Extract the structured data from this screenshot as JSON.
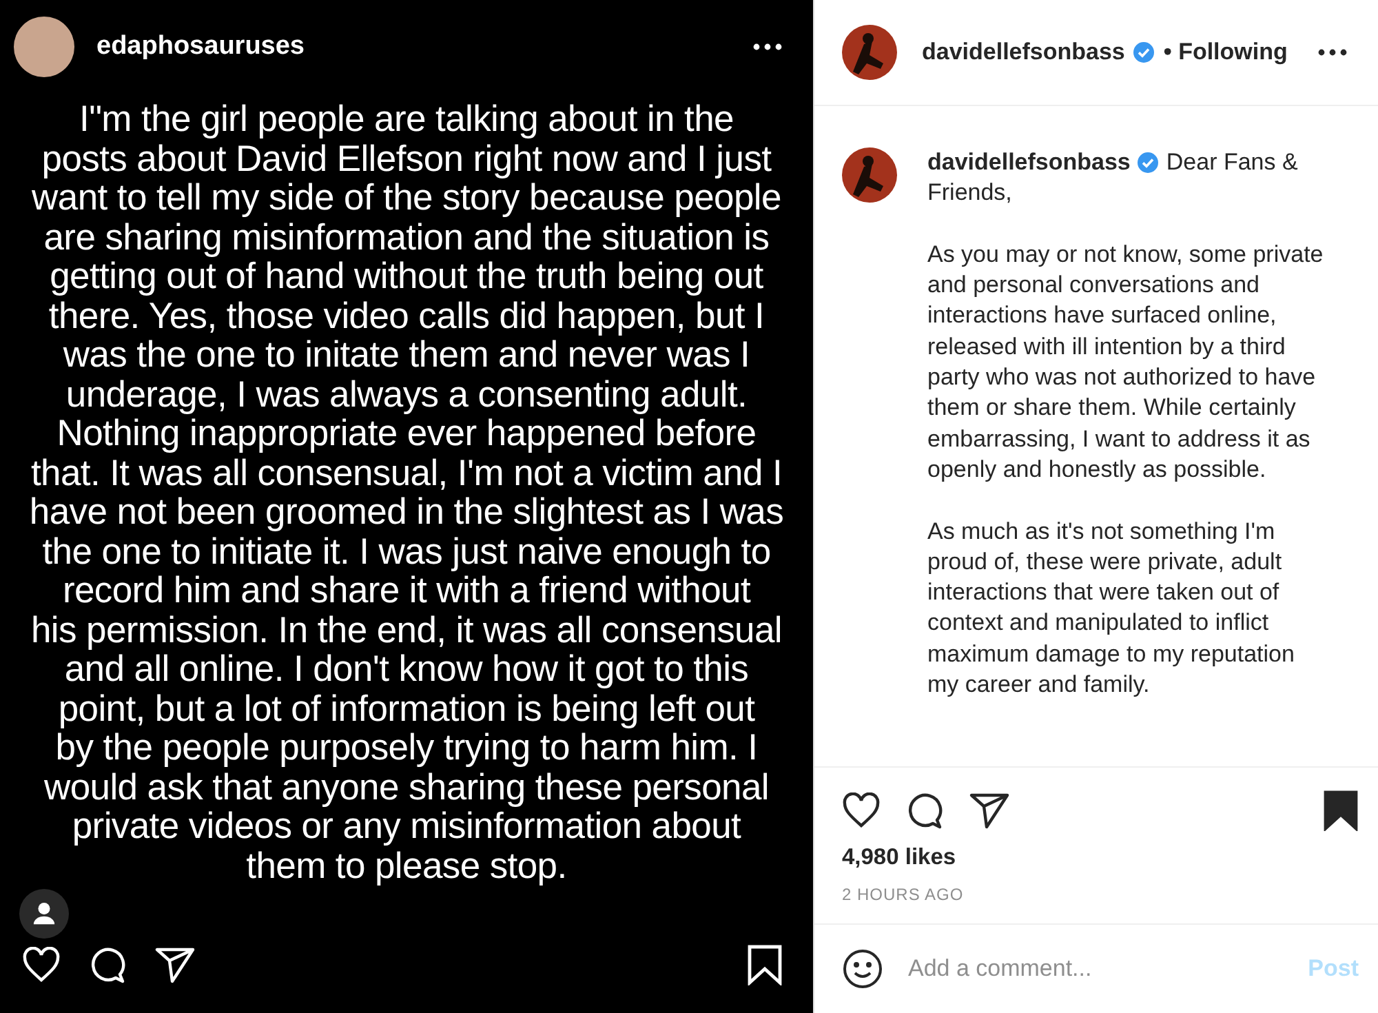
{
  "story": {
    "username": "edaphosauruses",
    "text": "I\"m the girl people are talking about in the\nposts about David Ellefson right now and I just\nwant to tell my side of the story because people\nare sharing misinformation and the situation is\ngetting out of hand without the truth being out\nthere. Yes, those video calls did happen, but I\nwas the one to initate them and never was I\nunderage, I was always a consenting adult.\nNothing inappropriate ever happened before\nthat. It was all consensual, I'm not a victim and I\nhave not been groomed in the slightest as I was\nthe one to initiate it. I was just naive enough to\nrecord him and share it with a friend without\nhis permission. In the end, it was all consensual\nand all online. I don't know how it got to this\npoint, but a lot of information is being left out\nby the people purposely trying to harm him. I\nwould ask that anyone sharing these personal\nprivate videos or any misinformation about\nthem to please stop.",
    "liked": false,
    "saved": false
  },
  "post": {
    "username": "davidellefsonbass",
    "verified": true,
    "follow_status": "• Following",
    "caption": {
      "username": "davidellefsonbass",
      "verified": true,
      "greeting": "Dear Fans &",
      "text": "Friends,\n\nAs you may or not know, some private and personal conversations and interactions have surfaced online, released with ill intention by a third party who was not authorized to have them or share them. While certainly embarrassing, I want to address it as openly and honestly as possible.\n\nAs much as it's not something I'm proud of, these were private, adult interactions that were taken out of context and manipulated to inflict maximum damage to my reputation my career and family."
    },
    "liked": false,
    "saved": true,
    "likes": "4,980 likes",
    "time": "2 HOURS AGO",
    "comment": {
      "placeholder": "Add a comment...",
      "post_label": "Post",
      "post_disabled": true
    }
  }
}
